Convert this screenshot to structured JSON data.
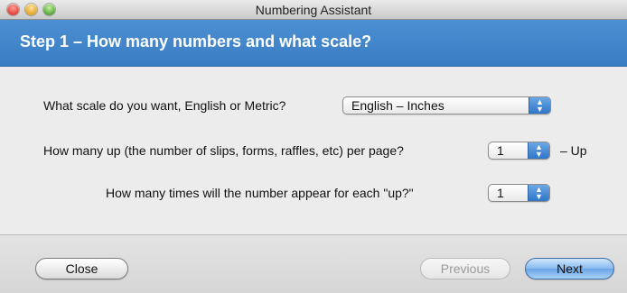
{
  "window": {
    "title": "Numbering Assistant"
  },
  "header": {
    "title": "Step 1 – How many numbers and what scale?"
  },
  "form": {
    "scale": {
      "label": "What scale do you want, English or Metric?",
      "value": "English – Inches"
    },
    "up": {
      "label": "How many up (the number of slips, forms, raffles, etc) per page?",
      "value": "1",
      "suffix": "– Up"
    },
    "times": {
      "label": "How many times will the number appear for each \"up?\"",
      "value": "1"
    }
  },
  "buttons": {
    "close": "Close",
    "previous": "Previous",
    "next": "Next"
  },
  "icons": {
    "close": "close-window-icon",
    "minimize": "minimize-window-icon",
    "zoom": "zoom-window-icon",
    "popup": "popup-arrows-icon"
  },
  "colors": {
    "header": "#3f83c8",
    "primary_button": "#7ab3ec"
  }
}
